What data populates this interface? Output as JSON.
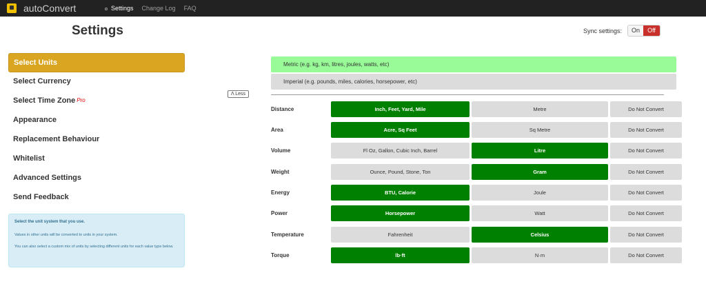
{
  "app": {
    "brand": "autoConvert",
    "logo_icon": "autoconvert-logo-icon"
  },
  "nav": [
    {
      "label": "Settings",
      "active": true
    },
    {
      "label": "Change Log",
      "active": false
    },
    {
      "label": "FAQ",
      "active": false
    }
  ],
  "page": {
    "title": "Settings"
  },
  "sync": {
    "label": "Sync settings:",
    "on": "On",
    "off": "Off",
    "state": "off"
  },
  "sidebar": {
    "items": [
      {
        "label": "Select Units",
        "active": true
      },
      {
        "label": "Select Currency"
      },
      {
        "label": "Select Time Zone",
        "badge": "Pro"
      },
      {
        "label": "Appearance"
      },
      {
        "label": "Replacement Behaviour"
      },
      {
        "label": "Whitelist"
      },
      {
        "label": "Advanced Settings"
      },
      {
        "label": "Send Feedback"
      }
    ]
  },
  "info": {
    "title": "Select the unit system that you use.",
    "p1": "Values in other units will be converted to units in your system.",
    "p2": "You can also select a custom mix of units by selecting different units for each value type below."
  },
  "less_button": "Λ Less",
  "systems": {
    "metric": "Metric (e.g. kg, km, litres, joules, watts, etc)",
    "imperial": "Imperial (e.g. pounds, miles, calories, horsepower, etc)"
  },
  "units": [
    {
      "label": "Distance",
      "opt1": "Inch, Feet, Yard, Mile",
      "opt2": "Metre",
      "opt3": "Do Not Convert",
      "selected": 1
    },
    {
      "label": "Area",
      "opt1": "Acre, Sq Feet",
      "opt2": "Sq Metre",
      "opt3": "Do Not Convert",
      "selected": 1
    },
    {
      "label": "Volume",
      "opt1": "Fl Oz, Gallon, Cubic Inch, Barrel",
      "opt2": "Litre",
      "opt3": "Do Not Convert",
      "selected": 2
    },
    {
      "label": "Weight",
      "opt1": "Ounce, Pound, Stone, Ton",
      "opt2": "Gram",
      "opt3": "Do Not Convert",
      "selected": 2
    },
    {
      "label": "Energy",
      "opt1": "BTU, Calorie",
      "opt2": "Joule",
      "opt3": "Do Not Convert",
      "selected": 1
    },
    {
      "label": "Power",
      "opt1": "Horsepower",
      "opt2": "Watt",
      "opt3": "Do Not Convert",
      "selected": 1
    },
    {
      "label": "Temperature",
      "opt1": "Fahrenheit",
      "opt2": "Celsius",
      "opt3": "Do Not Convert",
      "selected": 2
    },
    {
      "label": "Torque",
      "opt1": "lb·ft",
      "opt2": "N·m",
      "opt3": "Do Not Convert",
      "selected": 1
    }
  ],
  "colors": {
    "selected": "#008000",
    "active_sidebar": "#daa520",
    "metric": "#98fb98",
    "off": "#c9302c"
  }
}
